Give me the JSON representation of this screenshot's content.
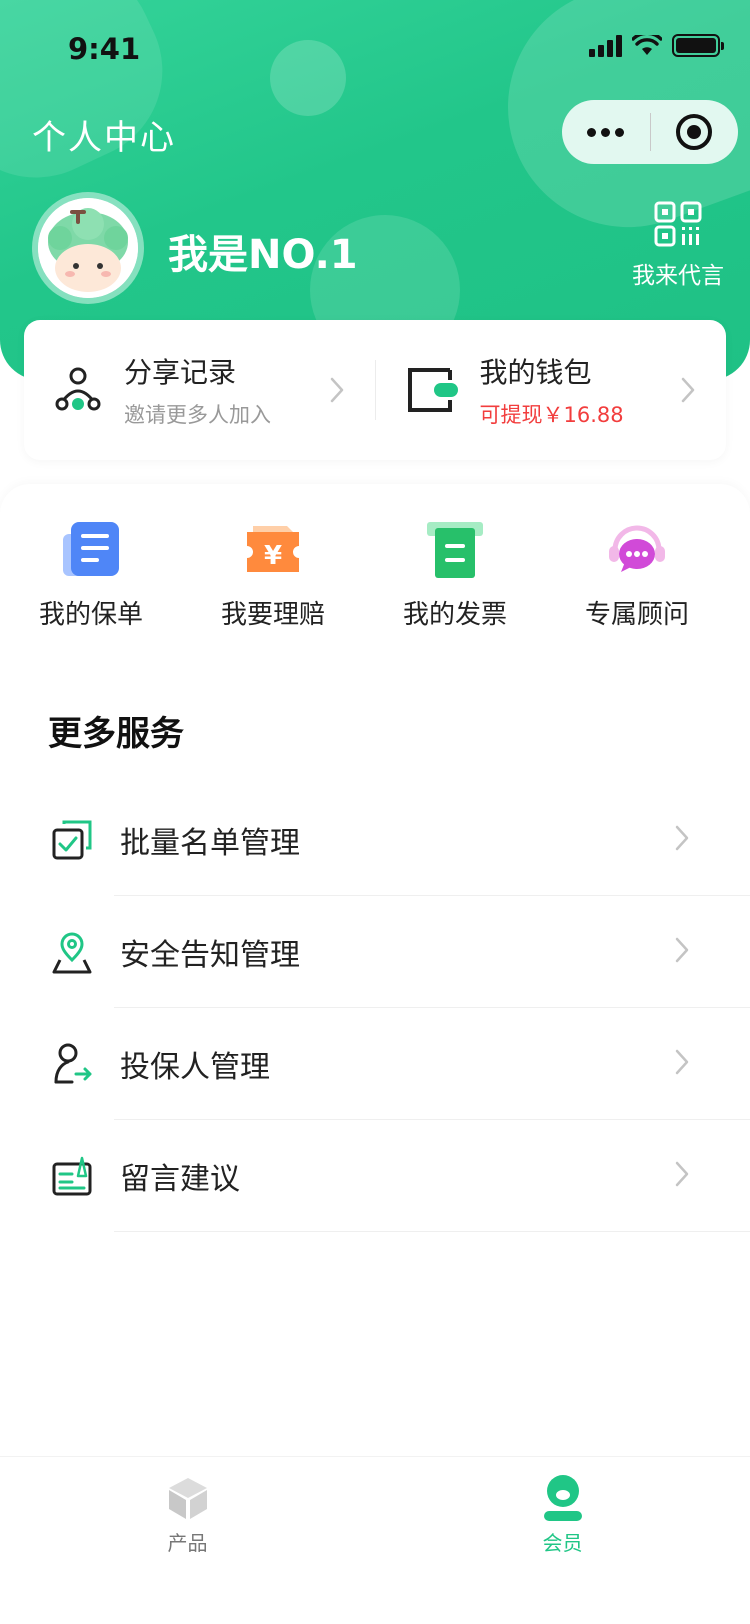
{
  "status_bar": {
    "time": "9:41"
  },
  "header": {
    "title": "个人中心",
    "username": "我是NO.1",
    "qr_label": "我来代言"
  },
  "colors": {
    "brand": "#20c686",
    "accent_red": "#f23d3d"
  },
  "card": {
    "share": {
      "title": "分享记录",
      "subtitle": "邀请更多人加入",
      "icon": "share-network-icon"
    },
    "wallet": {
      "title": "我的钱包",
      "subtitle": "可提现￥16.88",
      "icon": "wallet-icon"
    }
  },
  "quick_actions": [
    {
      "label": "我的保单",
      "icon": "policy-document-icon"
    },
    {
      "label": "我要理赔",
      "icon": "claim-yuan-icon"
    },
    {
      "label": "我的发票",
      "icon": "invoice-icon"
    },
    {
      "label": "专属顾问",
      "icon": "advisor-chat-icon"
    }
  ],
  "more_services": {
    "title": "更多服务",
    "items": [
      {
        "label": "批量名单管理",
        "icon": "batch-list-icon"
      },
      {
        "label": "安全告知管理",
        "icon": "location-pin-icon"
      },
      {
        "label": "投保人管理",
        "icon": "user-transfer-icon"
      },
      {
        "label": "留言建议",
        "icon": "feedback-note-icon"
      }
    ]
  },
  "tabbar": [
    {
      "label": "产品",
      "icon": "cube-icon",
      "active": false
    },
    {
      "label": "会员",
      "icon": "member-icon",
      "active": true
    }
  ]
}
